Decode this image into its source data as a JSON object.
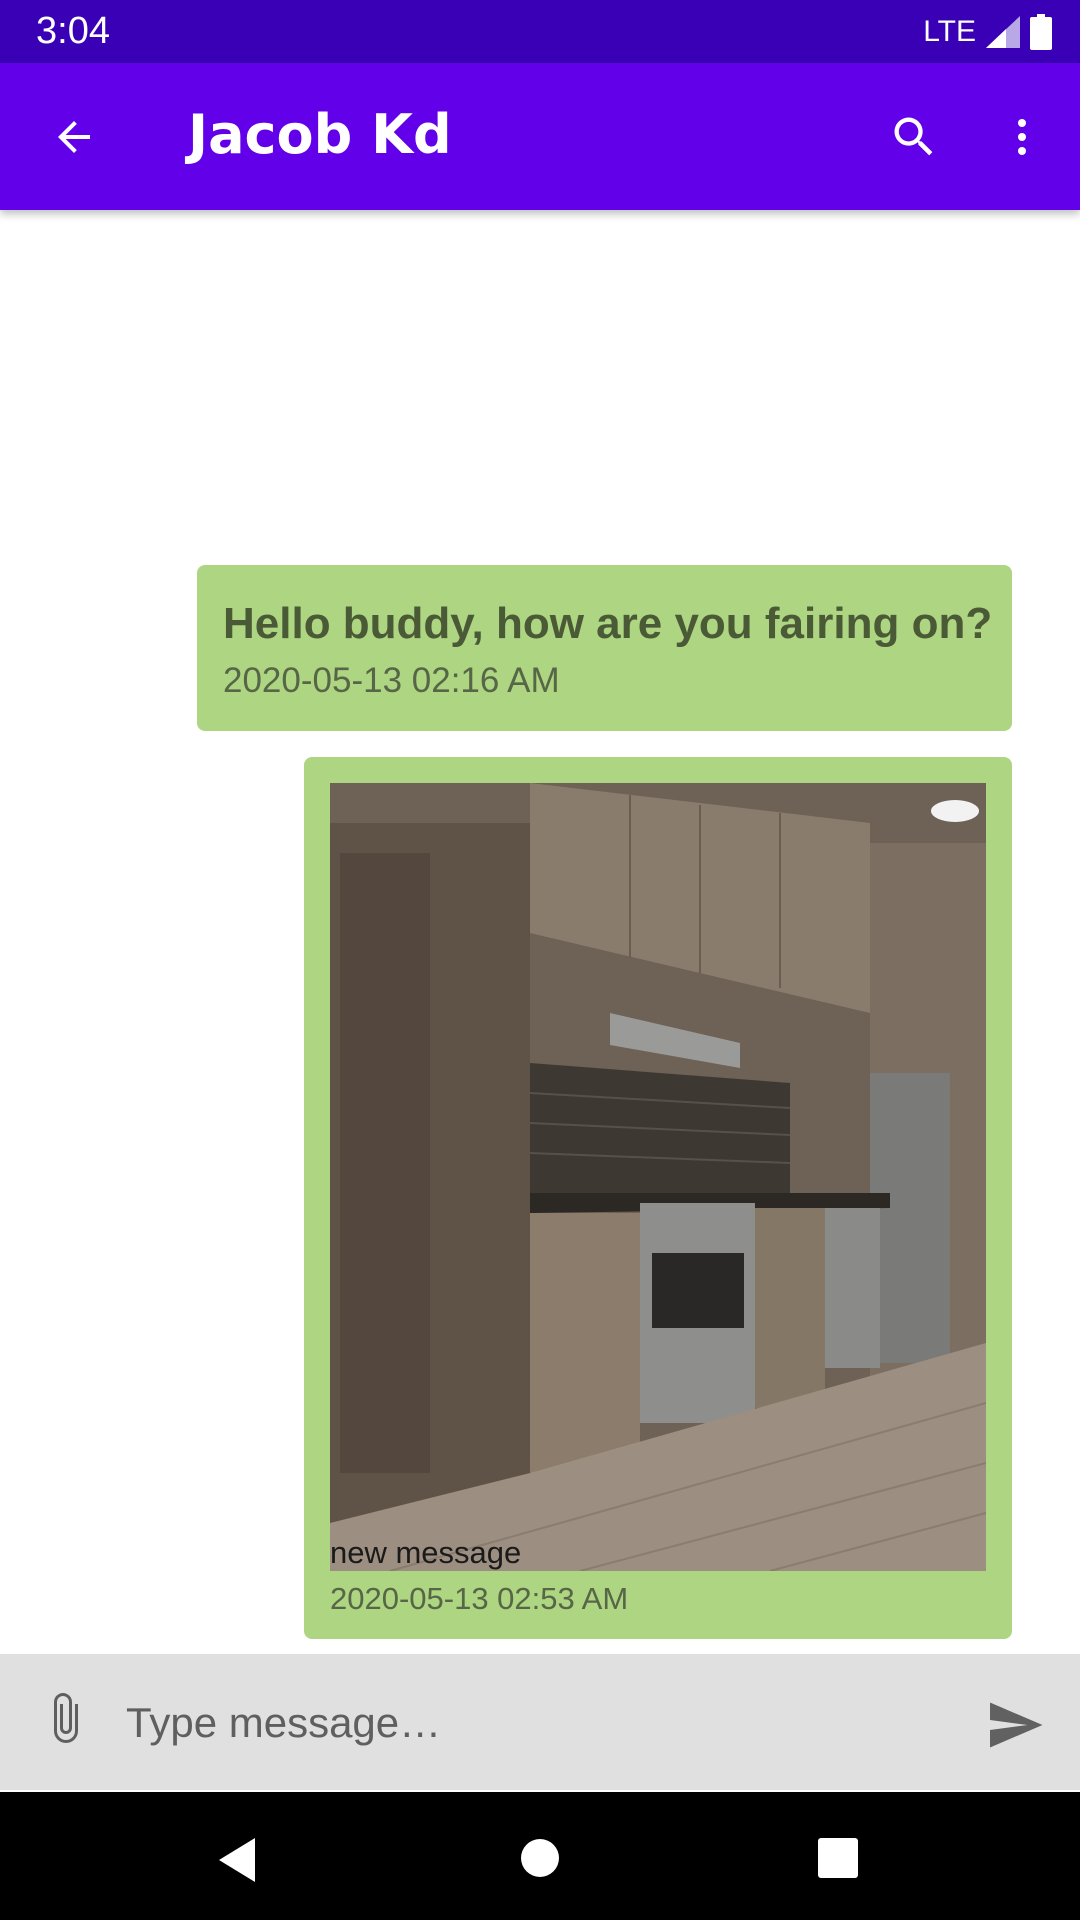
{
  "status_bar": {
    "time": "3:04",
    "network": "LTE"
  },
  "app_bar": {
    "title": "Jacob Kd",
    "back_icon": "arrow-back-icon",
    "search_icon": "search-icon",
    "more_icon": "more-vert-icon"
  },
  "messages": [
    {
      "type": "text",
      "text": "Hello buddy, how are you fairing on?",
      "time": "2020-05-13 02:16 AM"
    },
    {
      "type": "image",
      "image_desc": "kitchen photo",
      "caption": "new message",
      "time": "2020-05-13 02:53 AM"
    }
  ],
  "composer": {
    "placeholder": "Type message…",
    "value": "",
    "attach_icon": "paperclip-icon",
    "send_icon": "send-icon"
  },
  "nav_bar": {
    "back_icon": "nav-back-icon",
    "home_icon": "nav-home-icon",
    "recents_icon": "nav-recents-icon"
  },
  "colors": {
    "status_bar": "#3a00b6",
    "app_bar": "#6200ea",
    "bubble": "#aed581",
    "composer": "#e0e0e0"
  }
}
